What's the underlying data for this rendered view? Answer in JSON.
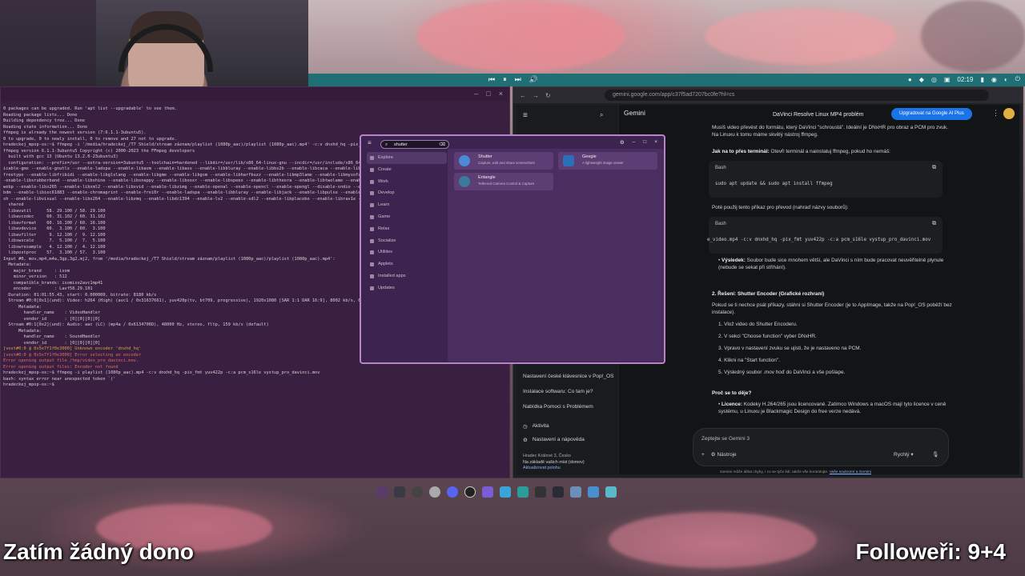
{
  "topbar": {
    "media": [
      "⏮",
      "⏸",
      "⏭",
      "🔊"
    ],
    "time": "02:19"
  },
  "terminal": {
    "lines": [
      {
        "t": "0 packages can be upgraded. Run 'apt list --upgradable' to see them.",
        "c": ""
      },
      {
        "t": "Reading package lists... Done",
        "c": ""
      },
      {
        "t": "Building dependency tree... Done",
        "c": ""
      },
      {
        "t": "Reading state information... Done",
        "c": ""
      },
      {
        "t": "ffmpeg is already the newest version (7:6.1.1-3ubuntu5).",
        "c": ""
      },
      {
        "t": "0 to upgrade, 0 to newly install, 0 to remove and 27 not to upgrade.",
        "c": ""
      },
      {
        "t": "hradeckej_mpop-os:~$ ffmpeg -i '/media/hradeckej_/T7 Shield/stream záznam/playlist (1080p_aac)/playlist (1080p_aac).mp4' -c:v dnxhd_hq -pix_fmt",
        "c": "prompt"
      },
      {
        "t": "ffmpeg version 6.1.1-3ubuntu5 Copyright (c) 2000-2023 the FFmpeg developers",
        "c": ""
      },
      {
        "t": "  built with gcc 13 (Ubuntu 13.2.0-23ubuntu3)",
        "c": ""
      },
      {
        "t": "  configuration: --prefix=/usr --extra-version=3ubuntu5 --toolchain=hardened --libdir=/usr/lib/x86_64-linux-gnu --incdir=/usr/include/x86_64-",
        "c": ""
      },
      {
        "t": "icable-gmx --enable-gnutls --enable-ladspa --enable-libaom --enable-libass --enable-libbluray --enable-libbs2b --enable-libcaca --enable-libcodec2 --enable-lib",
        "c": ""
      },
      {
        "t": "freetype --enable-libfribidi --enable-libglslang --enable-libgme --enable-libgsm --enable-libharfbuzz --enable-libmp3lame --enable-libmysofa --enable-",
        "c": ""
      },
      {
        "t": "-enable-libsrubberband --enable-libshine --enable-libsnappy --enable-libsoxr --enable-libspeex --enable-libtheora --enable-libtwolame --enable-libvidstab",
        "c": ""
      },
      {
        "t": "webp --enable-libx265 --enable-libxml2 --enable-libxvid --enable-libzimg --enable-openal --enable-opencl --enable-opengl --disable-sndio --enable-libvpl",
        "c": ""
      },
      {
        "t": "bdm --enable-libiec61883 --enable-chromaprint --enable-frei0r --enable-ladspa --enable-libbluray --enable-libjack --enable-libpulse --enable-librabbitmq",
        "c": ""
      },
      {
        "t": "sh --enable-libvisual --enable-libx264 --enable-libzmq --enable-libdc1394 --enable-lv2 --enable-sdl2 --enable-libplacebo --enable-librav1e --enable-pocket",
        "c": ""
      },
      {
        "t": "  shared",
        "c": ""
      },
      {
        "t": "  libavutil      58. 29.100 / 58. 29.100",
        "c": ""
      },
      {
        "t": "  libavcodec     60. 31.102 / 60. 31.102",
        "c": ""
      },
      {
        "t": "  libavformat    60. 16.100 / 60. 16.100",
        "c": ""
      },
      {
        "t": "  libavdevice    60.  3.100 / 60.  3.100",
        "c": ""
      },
      {
        "t": "  libavfilter     9. 12.100 /  9. 12.100",
        "c": ""
      },
      {
        "t": "  libswscale      7.  5.100 /  7.  5.100",
        "c": ""
      },
      {
        "t": "  libswresample   4. 12.100 /  4. 12.100",
        "c": ""
      },
      {
        "t": "  libpostproc    57.  3.100 / 57.  3.100",
        "c": ""
      },
      {
        "t": "Input #0, mov,mp4,m4a,3gp,3g2,mj2, from '/media/hradeckej_/T7 Shield/stream záznam/playlist (1080p_aac)/playlist (1080p_aac).mp4':",
        "c": ""
      },
      {
        "t": "  Metadata:",
        "c": ""
      },
      {
        "t": "    major_brand     : isom",
        "c": ""
      },
      {
        "t": "    minor_version   : 512",
        "c": ""
      },
      {
        "t": "    compatible_brands: isomiso2avc1mp41",
        "c": ""
      },
      {
        "t": "    encoder         : Lavf58.29.101",
        "c": ""
      },
      {
        "t": "  Duration: 01:01:55.43, start: 0.000000, bitrate: 8180 kb/s",
        "c": ""
      },
      {
        "t": "  Stream #0:0[0x1](und): Video: h264 (High) (avc1 / 0x31637661), yuv420p(tv, bt709, progressive), 1920x1080 [SAR 1:1 DAR 16:9], 8002 kb/s, 60 fps, 60 tbr, 90k tbn (default)",
        "c": ""
      },
      {
        "t": "      Metadata:",
        "c": ""
      },
      {
        "t": "        handler_name    : VideoHandler",
        "c": ""
      },
      {
        "t": "        vendor_id       : [0][0][0][0]",
        "c": ""
      },
      {
        "t": "  Stream #0:1[0x2](und): Audio: aac (LC) (mp4a / 0x6134706D), 48000 Hz, stereo, fltp, 159 kb/s (default)",
        "c": ""
      },
      {
        "t": "      Metadata:",
        "c": ""
      },
      {
        "t": "        handler_name    : SoundHandler",
        "c": ""
      },
      {
        "t": "        vendor_id       : [0][0][0][0]",
        "c": ""
      },
      {
        "t": "[vost#0:0 @ 0x5e7f1f0e3000] Unknown encoder 'dnxhd_hq'",
        "c": "warn"
      },
      {
        "t": "[vost#0:0 @ 0x5e7f1f0e3000] Error selecting an encoder",
        "c": "err"
      },
      {
        "t": "Error opening output file /tmp/video_pro_davinci.mov.",
        "c": "err"
      },
      {
        "t": "Error opening output files: Encoder not found",
        "c": "err"
      },
      {
        "t": "hradeckej_mpop-os:~$ ffmpeg -i playlist (1080p_aac).mp4 -c:v dnxhd_hq -pix_fmt yuv422p -c:a pcm_s16le vystup_pro_davinci.mov",
        "c": "prompt"
      },
      {
        "t": "bash: syntax error near unexpected token `('",
        "c": ""
      },
      {
        "t": "hradeckej_mpop-os:~$ ",
        "c": "prompt"
      }
    ]
  },
  "browser": {
    "url": "gemini.google.com/app/c37f5ad7207bc0fe?hl=cs",
    "app_name": "Gemini",
    "chat_title": "DaVinci Resolve Linux MP4 problém",
    "upgrade_label": "Upgradovat na Google AI Plus",
    "sidebar_items": [
      "Nastavení české klávesnice v Pop!_OS",
      "Instalace softwaru: Co tam je?",
      "Nabídka Pomoci s Problémem"
    ],
    "activity": "Aktivita",
    "settings": "Nastavení a nápověda",
    "location_city": "Hradec Králové 3, Česko",
    "location_note": "Na základě vašich míst (domov)",
    "location_update": "Aktualizovat polohu",
    "p1": "Musíš video převést do formátu, který DaVinci \"schroustá\". Ideální je DNxHR pro obraz a PCM pro zvuk. Na Linuxu k tomu máme skvělý nástroj ffmpeg.",
    "h1": "Jak na to přes terminál:",
    "h1_rest": " Otevři terminál a nainstaluj ffmpeg, pokud ho nemáš:",
    "code1_lang": "Bash",
    "code1": "sudo apt update && sudo apt install ffmpeg",
    "p2": "Poté použij tento příkaz pro převod (nahraď názvy souborů):",
    "code2_lang": "Bash",
    "code2": "e_video.mp4 -c:v dnxhd_hq -pix_fmt yuv422p -c:a pcm_s16le vystup_pro_davinci.mov",
    "bullet1_b": "Výsledek:",
    "bullet1": " Soubor bude sice mnohem větší, ale DaVinci s ním bude pracovat neuvěřitelně plynule (nebude se sekat při stříhání).",
    "h2": "2. Řešení: Shutter Encoder (Grafické rozhraní)",
    "p3": "Pokud se ti nechce psát příkazy, stáhni si Shutter Encoder (je to AppImage, takže na Pop!_OS poběží bez instalace).",
    "steps": [
      "Vlož video do Shutter Encoderu.",
      "V sekci \"Choose function\" vyber DNxHR.",
      "Vpravo v nastavení zvuku se ujisti, že je nastaveno na PCM.",
      "Klikni na \"Start function\".",
      "Výsledný soubor .mov hoď do DaVinci a vše pošlape."
    ],
    "h3": "Proč se to děje?",
    "bullet2_b": "Licence:",
    "bullet2": " Kodeky H.264/265 jsou licencované. Zatímco Windows a macOS mají tyto licence v ceně systému, u Linuxu je Blackmagic Design do free verze nedává.",
    "input_placeholder": "Zeptejte se Gemini 3",
    "tools_label": "Nástroje",
    "mode_label": "Rychlý",
    "disclaimer": "Gemini může dělat chyby, i co se týče lidí, takže vše kontrolujte.",
    "disclaimer_link": "Vaše soukromí a Gemini"
  },
  "launcher": {
    "search_value": "shutter",
    "categories": [
      "Explore",
      "Create",
      "Work",
      "Develop",
      "Learn",
      "Game",
      "Relax",
      "Socialize",
      "Utilities",
      "Applets",
      "Installed apps",
      "Updates"
    ],
    "apps": [
      {
        "name": "Shutter",
        "desc": "Capture, edit and share screenshots",
        "color": "#4a8ad8"
      },
      {
        "name": "Geegie",
        "desc": "A lightweight image viewer",
        "color": "#2c6fb8"
      },
      {
        "name": "Entangle",
        "desc": "Tethered Camera Control & Capture",
        "color": "#3b7a9c"
      }
    ]
  },
  "overlay": {
    "left": "Zatím žádný dono",
    "right": "Followeři: 9+4"
  }
}
